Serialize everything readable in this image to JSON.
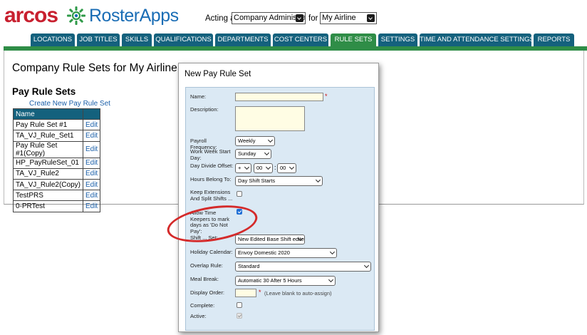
{
  "header": {
    "logo_arcos": "arcos",
    "logo_rosterapps": "RosterApps",
    "acting_as_label": "Acting as",
    "role_value": "Company Administrator",
    "for_label": "for",
    "airline_value": "My Airline"
  },
  "nav": {
    "tabs": [
      {
        "label": "LOCATIONS"
      },
      {
        "label": "JOB TITLES"
      },
      {
        "label": "SKILLS"
      },
      {
        "label": "QUALIFICATIONS"
      },
      {
        "label": "DEPARTMENTS"
      },
      {
        "label": "COST CENTERS"
      },
      {
        "label": "RULE SETS",
        "active": true
      },
      {
        "label": "SETTINGS"
      },
      {
        "label": "TIME AND ATTENDANCE SETTINGS"
      },
      {
        "label": "REPORTS"
      }
    ]
  },
  "main": {
    "page_title": "Company Rule Sets for My Airline",
    "section_title": "Pay Rule Sets",
    "create_link": "Create New Pay Rule Set",
    "table": {
      "header": "Name",
      "rows": [
        {
          "name": "Pay Rule Set #1",
          "action": "Edit"
        },
        {
          "name": "TA_VJ_Rule_Set1",
          "action": "Edit"
        },
        {
          "name": "Pay Rule Set #1(Copy)",
          "action": "Edit"
        },
        {
          "name": "HP_PayRuleSet_01",
          "action": "Edit"
        },
        {
          "name": "TA_VJ_Rule2",
          "action": "Edit"
        },
        {
          "name": "TA_VJ_Rule2(Copy)",
          "action": "Edit"
        },
        {
          "name": "TestPRS",
          "action": "Edit"
        },
        {
          "name": "0-PRTest",
          "action": "Edit"
        }
      ]
    }
  },
  "modal": {
    "title": "New Pay Rule Set",
    "name_label": "Name:",
    "name_value": "",
    "required_mark": "*",
    "description_label": "Description:",
    "description_value": "",
    "payroll_frequency_label": "Payroll Frequency:",
    "payroll_frequency_value": "Weekly",
    "work_week_start_label": "Work Week Start Day:",
    "work_week_start_value": "Sunday",
    "day_divide_offset_label": "Day Divide Offset:",
    "day_divide_sign": "+",
    "day_divide_hours": "00",
    "day_divide_sep": ":",
    "day_divide_minutes": "00",
    "hours_belong_label": "Hours Belong To:",
    "hours_belong_value": "Day Shift Starts",
    "keep_extensions_label": "Keep Extensions And Split Shifts ... Original Shift:",
    "keep_extensions_checked": false,
    "allow_time_keepers_label": "Allow Time Keepers to mark days as 'Do Not Pay':",
    "allow_time_keepers_checked": true,
    "shift_set_label": "Shift ... Set:",
    "shift_set_value": "New Edited Base Shift edited",
    "holiday_calendar_label": "Holiday Calendar:",
    "holiday_calendar_value": "Envoy Domestic 2020",
    "overlap_rule_label": "Overlap Rule:",
    "overlap_rule_value": "Standard",
    "meal_break_label": "Meal Break:",
    "meal_break_value": "Automatic 30 After 5 Hours",
    "display_order_label": "Display Order:",
    "display_order_value": "",
    "display_order_hint": "(Leave blank to auto-assign)",
    "complete_label": "Complete:",
    "complete_checked": false,
    "active_label": "Active:",
    "active_checked": true
  },
  "colors": {
    "nav_tab": "#14617d",
    "nav_active": "#2f8d47",
    "brand_red": "#c8202f",
    "brand_blue": "#1a6db5",
    "panel_bg": "#dbe9f4",
    "annotation": "#d42a2a"
  }
}
